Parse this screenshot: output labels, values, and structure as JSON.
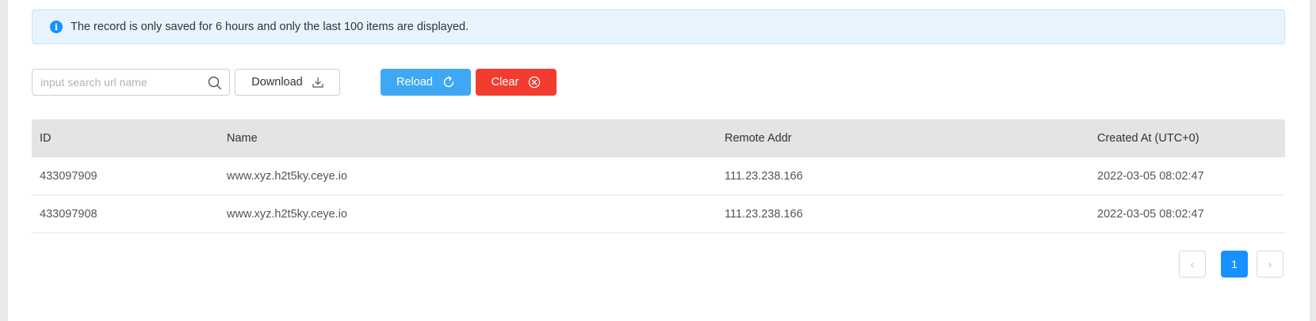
{
  "alert": {
    "icon": "info-icon",
    "text": "The record is only saved for 6 hours and only the last 100 items are displayed."
  },
  "toolbar": {
    "search": {
      "placeholder": "input search url name",
      "value": ""
    },
    "download_label": "Download",
    "reload_label": "Reload",
    "clear_label": "Clear"
  },
  "colors": {
    "reload": "#3fa8f4",
    "clear": "#f23c30",
    "page_active": "#1890ff",
    "alert_bg": "#e8f4fd"
  },
  "table": {
    "columns": [
      "ID",
      "Name",
      "Remote Addr",
      "Created At (UTC+0)"
    ],
    "rows": [
      [
        "433097909",
        "www.xyz.h2t5ky.ceye.io",
        "111.23.238.166",
        "2022-03-05 08:02:47"
      ],
      [
        "433097908",
        "www.xyz.h2t5ky.ceye.io",
        "111.23.238.166",
        "2022-03-05 08:02:47"
      ]
    ]
  },
  "pagination": {
    "prev": "‹",
    "current": "1",
    "next": "›"
  }
}
